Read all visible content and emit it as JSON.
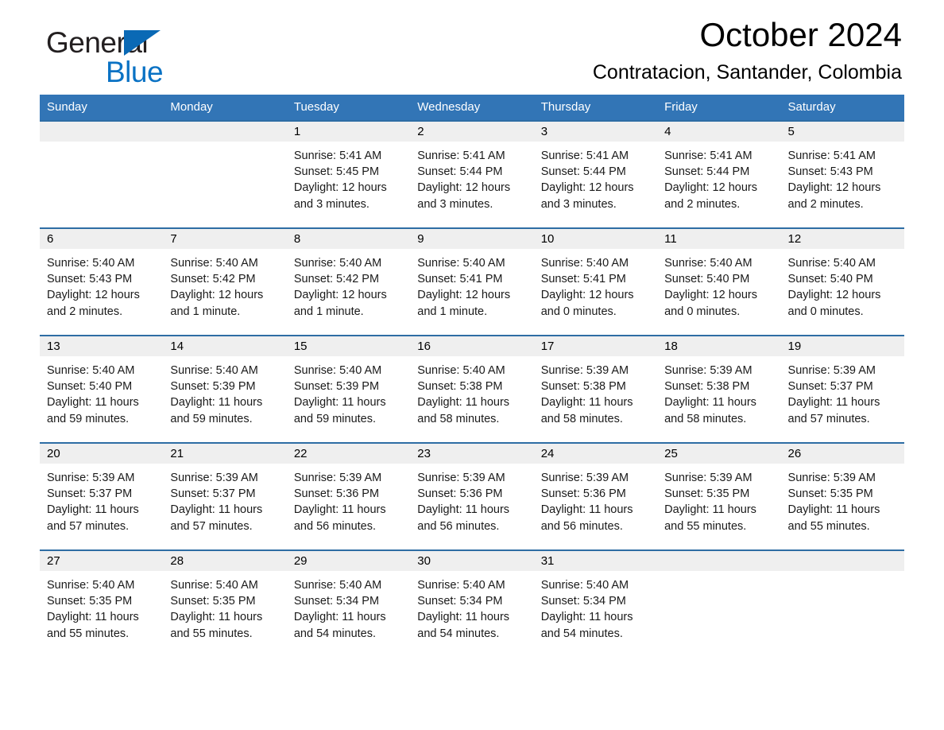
{
  "brand": {
    "name_part1": "General",
    "name_part2": "Blue",
    "accent_color": "#0a72c4",
    "triangle_color": "#0a69b5"
  },
  "header": {
    "month_title": "October 2024",
    "location": "Contratacion, Santander, Colombia"
  },
  "calendar": {
    "header_bg": "#3275b6",
    "row_border_color": "#2e6da4",
    "daynum_band_bg": "#efefef",
    "weekday_headers": [
      "Sunday",
      "Monday",
      "Tuesday",
      "Wednesday",
      "Thursday",
      "Friday",
      "Saturday"
    ],
    "weeks": [
      [
        {
          "day": "",
          "empty": true,
          "sunrise": "",
          "sunset": "",
          "daylight_l1": "",
          "daylight_l2": ""
        },
        {
          "day": "",
          "empty": true,
          "sunrise": "",
          "sunset": "",
          "daylight_l1": "",
          "daylight_l2": ""
        },
        {
          "day": "1",
          "empty": false,
          "sunrise": "Sunrise: 5:41 AM",
          "sunset": "Sunset: 5:45 PM",
          "daylight_l1": "Daylight: 12 hours",
          "daylight_l2": "and 3 minutes."
        },
        {
          "day": "2",
          "empty": false,
          "sunrise": "Sunrise: 5:41 AM",
          "sunset": "Sunset: 5:44 PM",
          "daylight_l1": "Daylight: 12 hours",
          "daylight_l2": "and 3 minutes."
        },
        {
          "day": "3",
          "empty": false,
          "sunrise": "Sunrise: 5:41 AM",
          "sunset": "Sunset: 5:44 PM",
          "daylight_l1": "Daylight: 12 hours",
          "daylight_l2": "and 3 minutes."
        },
        {
          "day": "4",
          "empty": false,
          "sunrise": "Sunrise: 5:41 AM",
          "sunset": "Sunset: 5:44 PM",
          "daylight_l1": "Daylight: 12 hours",
          "daylight_l2": "and 2 minutes."
        },
        {
          "day": "5",
          "empty": false,
          "sunrise": "Sunrise: 5:41 AM",
          "sunset": "Sunset: 5:43 PM",
          "daylight_l1": "Daylight: 12 hours",
          "daylight_l2": "and 2 minutes."
        }
      ],
      [
        {
          "day": "6",
          "empty": false,
          "sunrise": "Sunrise: 5:40 AM",
          "sunset": "Sunset: 5:43 PM",
          "daylight_l1": "Daylight: 12 hours",
          "daylight_l2": "and 2 minutes."
        },
        {
          "day": "7",
          "empty": false,
          "sunrise": "Sunrise: 5:40 AM",
          "sunset": "Sunset: 5:42 PM",
          "daylight_l1": "Daylight: 12 hours",
          "daylight_l2": "and 1 minute."
        },
        {
          "day": "8",
          "empty": false,
          "sunrise": "Sunrise: 5:40 AM",
          "sunset": "Sunset: 5:42 PM",
          "daylight_l1": "Daylight: 12 hours",
          "daylight_l2": "and 1 minute."
        },
        {
          "day": "9",
          "empty": false,
          "sunrise": "Sunrise: 5:40 AM",
          "sunset": "Sunset: 5:41 PM",
          "daylight_l1": "Daylight: 12 hours",
          "daylight_l2": "and 1 minute."
        },
        {
          "day": "10",
          "empty": false,
          "sunrise": "Sunrise: 5:40 AM",
          "sunset": "Sunset: 5:41 PM",
          "daylight_l1": "Daylight: 12 hours",
          "daylight_l2": "and 0 minutes."
        },
        {
          "day": "11",
          "empty": false,
          "sunrise": "Sunrise: 5:40 AM",
          "sunset": "Sunset: 5:40 PM",
          "daylight_l1": "Daylight: 12 hours",
          "daylight_l2": "and 0 minutes."
        },
        {
          "day": "12",
          "empty": false,
          "sunrise": "Sunrise: 5:40 AM",
          "sunset": "Sunset: 5:40 PM",
          "daylight_l1": "Daylight: 12 hours",
          "daylight_l2": "and 0 minutes."
        }
      ],
      [
        {
          "day": "13",
          "empty": false,
          "sunrise": "Sunrise: 5:40 AM",
          "sunset": "Sunset: 5:40 PM",
          "daylight_l1": "Daylight: 11 hours",
          "daylight_l2": "and 59 minutes."
        },
        {
          "day": "14",
          "empty": false,
          "sunrise": "Sunrise: 5:40 AM",
          "sunset": "Sunset: 5:39 PM",
          "daylight_l1": "Daylight: 11 hours",
          "daylight_l2": "and 59 minutes."
        },
        {
          "day": "15",
          "empty": false,
          "sunrise": "Sunrise: 5:40 AM",
          "sunset": "Sunset: 5:39 PM",
          "daylight_l1": "Daylight: 11 hours",
          "daylight_l2": "and 59 minutes."
        },
        {
          "day": "16",
          "empty": false,
          "sunrise": "Sunrise: 5:40 AM",
          "sunset": "Sunset: 5:38 PM",
          "daylight_l1": "Daylight: 11 hours",
          "daylight_l2": "and 58 minutes."
        },
        {
          "day": "17",
          "empty": false,
          "sunrise": "Sunrise: 5:39 AM",
          "sunset": "Sunset: 5:38 PM",
          "daylight_l1": "Daylight: 11 hours",
          "daylight_l2": "and 58 minutes."
        },
        {
          "day": "18",
          "empty": false,
          "sunrise": "Sunrise: 5:39 AM",
          "sunset": "Sunset: 5:38 PM",
          "daylight_l1": "Daylight: 11 hours",
          "daylight_l2": "and 58 minutes."
        },
        {
          "day": "19",
          "empty": false,
          "sunrise": "Sunrise: 5:39 AM",
          "sunset": "Sunset: 5:37 PM",
          "daylight_l1": "Daylight: 11 hours",
          "daylight_l2": "and 57 minutes."
        }
      ],
      [
        {
          "day": "20",
          "empty": false,
          "sunrise": "Sunrise: 5:39 AM",
          "sunset": "Sunset: 5:37 PM",
          "daylight_l1": "Daylight: 11 hours",
          "daylight_l2": "and 57 minutes."
        },
        {
          "day": "21",
          "empty": false,
          "sunrise": "Sunrise: 5:39 AM",
          "sunset": "Sunset: 5:37 PM",
          "daylight_l1": "Daylight: 11 hours",
          "daylight_l2": "and 57 minutes."
        },
        {
          "day": "22",
          "empty": false,
          "sunrise": "Sunrise: 5:39 AM",
          "sunset": "Sunset: 5:36 PM",
          "daylight_l1": "Daylight: 11 hours",
          "daylight_l2": "and 56 minutes."
        },
        {
          "day": "23",
          "empty": false,
          "sunrise": "Sunrise: 5:39 AM",
          "sunset": "Sunset: 5:36 PM",
          "daylight_l1": "Daylight: 11 hours",
          "daylight_l2": "and 56 minutes."
        },
        {
          "day": "24",
          "empty": false,
          "sunrise": "Sunrise: 5:39 AM",
          "sunset": "Sunset: 5:36 PM",
          "daylight_l1": "Daylight: 11 hours",
          "daylight_l2": "and 56 minutes."
        },
        {
          "day": "25",
          "empty": false,
          "sunrise": "Sunrise: 5:39 AM",
          "sunset": "Sunset: 5:35 PM",
          "daylight_l1": "Daylight: 11 hours",
          "daylight_l2": "and 55 minutes."
        },
        {
          "day": "26",
          "empty": false,
          "sunrise": "Sunrise: 5:39 AM",
          "sunset": "Sunset: 5:35 PM",
          "daylight_l1": "Daylight: 11 hours",
          "daylight_l2": "and 55 minutes."
        }
      ],
      [
        {
          "day": "27",
          "empty": false,
          "sunrise": "Sunrise: 5:40 AM",
          "sunset": "Sunset: 5:35 PM",
          "daylight_l1": "Daylight: 11 hours",
          "daylight_l2": "and 55 minutes."
        },
        {
          "day": "28",
          "empty": false,
          "sunrise": "Sunrise: 5:40 AM",
          "sunset": "Sunset: 5:35 PM",
          "daylight_l1": "Daylight: 11 hours",
          "daylight_l2": "and 55 minutes."
        },
        {
          "day": "29",
          "empty": false,
          "sunrise": "Sunrise: 5:40 AM",
          "sunset": "Sunset: 5:34 PM",
          "daylight_l1": "Daylight: 11 hours",
          "daylight_l2": "and 54 minutes."
        },
        {
          "day": "30",
          "empty": false,
          "sunrise": "Sunrise: 5:40 AM",
          "sunset": "Sunset: 5:34 PM",
          "daylight_l1": "Daylight: 11 hours",
          "daylight_l2": "and 54 minutes."
        },
        {
          "day": "31",
          "empty": false,
          "sunrise": "Sunrise: 5:40 AM",
          "sunset": "Sunset: 5:34 PM",
          "daylight_l1": "Daylight: 11 hours",
          "daylight_l2": "and 54 minutes."
        },
        {
          "day": "",
          "empty": true,
          "sunrise": "",
          "sunset": "",
          "daylight_l1": "",
          "daylight_l2": ""
        },
        {
          "day": "",
          "empty": true,
          "sunrise": "",
          "sunset": "",
          "daylight_l1": "",
          "daylight_l2": ""
        }
      ]
    ]
  }
}
